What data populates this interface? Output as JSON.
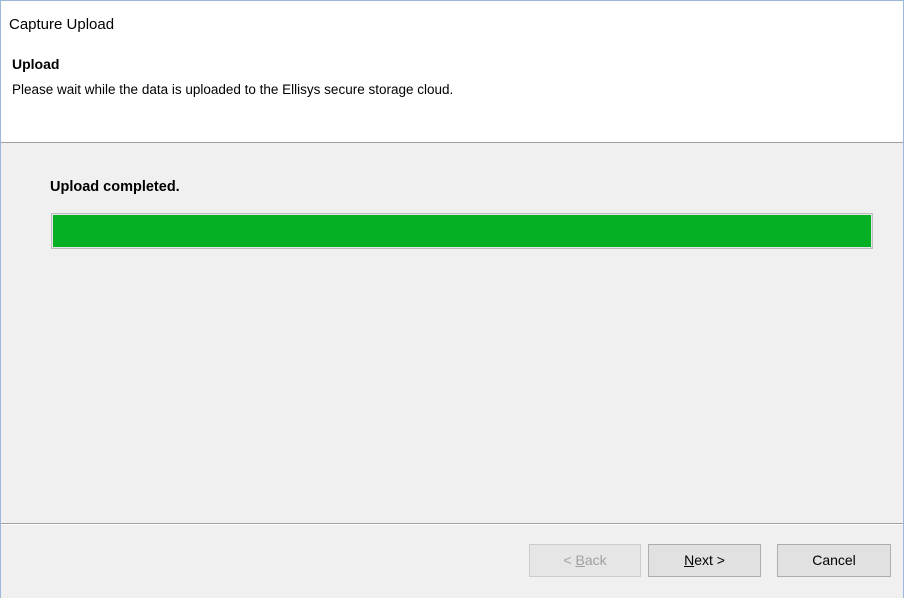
{
  "window": {
    "title": "Capture Upload"
  },
  "header": {
    "title": "Upload",
    "subtitle": "Please wait while the data is uploaded to the Ellisys secure storage cloud."
  },
  "main": {
    "status": "Upload completed.",
    "progress_percent": 100,
    "progress_color": "#06b025"
  },
  "buttons": {
    "back": {
      "prefix": "< ",
      "mnemonic": "B",
      "rest": "ack",
      "enabled": false
    },
    "next": {
      "prefix": "",
      "mnemonic": "N",
      "rest": "ext >",
      "enabled": true
    },
    "cancel": {
      "label": "Cancel",
      "enabled": true
    }
  }
}
